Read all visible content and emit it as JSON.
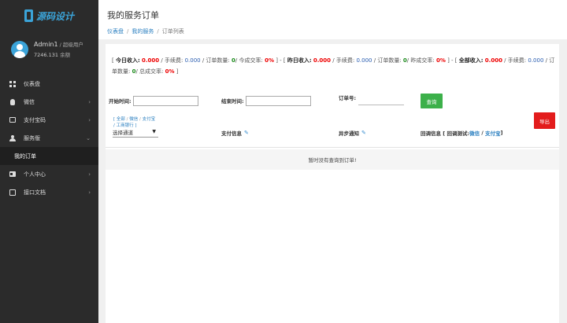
{
  "app": {
    "logo_text": "源码设计"
  },
  "user": {
    "name": "Admin1",
    "role_sep": " / ",
    "role": "超级用户",
    "balance": "7246.131",
    "balance_unit": " 余额"
  },
  "sidebar": {
    "items": [
      {
        "label": "仪表盘",
        "icon": "grid-icon",
        "arrow": ""
      },
      {
        "label": "微信",
        "icon": "wechat-icon",
        "arrow": "›"
      },
      {
        "label": "支付宝码",
        "icon": "card-icon",
        "arrow": "›"
      },
      {
        "label": "服务版",
        "icon": "user-icon",
        "arrow": "⌄"
      },
      {
        "label": "我的订单",
        "icon": "",
        "arrow": ""
      },
      {
        "label": "个人中心",
        "icon": "id-card-icon",
        "arrow": "›"
      },
      {
        "label": "接口文档",
        "icon": "document-icon",
        "arrow": "›"
      }
    ]
  },
  "header": {
    "title": "我的服务订单",
    "breadcrumb": [
      "仪表盘",
      "我的服务",
      "订单列表"
    ]
  },
  "stats": {
    "today_income_label": "今日收入:",
    "today_income": "0.000",
    "fee_label": " / 手续费: ",
    "today_fee": "0.000",
    "count_label": " / 订单数量: ",
    "today_count": "0",
    "rate_today_label": "/ 今成交率: ",
    "today_rate": "0%",
    "yesterday_income_label": "昨日收入:",
    "yesterday_income": "0.000",
    "yesterday_fee": "0.000",
    "yesterday_count": "0",
    "rate_yesterday_label": "/ 昨成交率: ",
    "yesterday_rate": "0%",
    "total_income_label": "全部收入:",
    "total_income": "0.000",
    "total_fee": "0.000",
    "total_count": "0",
    "rate_total_label": "/ 总成交率: ",
    "total_rate": "0%"
  },
  "filter": {
    "start_label": "开始时间:",
    "end_label": "结束时间:",
    "order_no_label": "订单号:",
    "query_button": "查询",
    "export_button": "导出"
  },
  "table": {
    "quick": {
      "all": "全部",
      "wechat": "微信",
      "alipay": "支付宝",
      "bank": "工商银行"
    },
    "channel_select": "选择通道",
    "col_payment": "支付信息",
    "col_async": "异步通知",
    "col_callback": "回调信息 [ 回调测试: ",
    "callback_wechat": "微信",
    "callback_alipay": "支付宝",
    "callback_end": " ]",
    "empty": "暂时没有查询到订单!"
  }
}
